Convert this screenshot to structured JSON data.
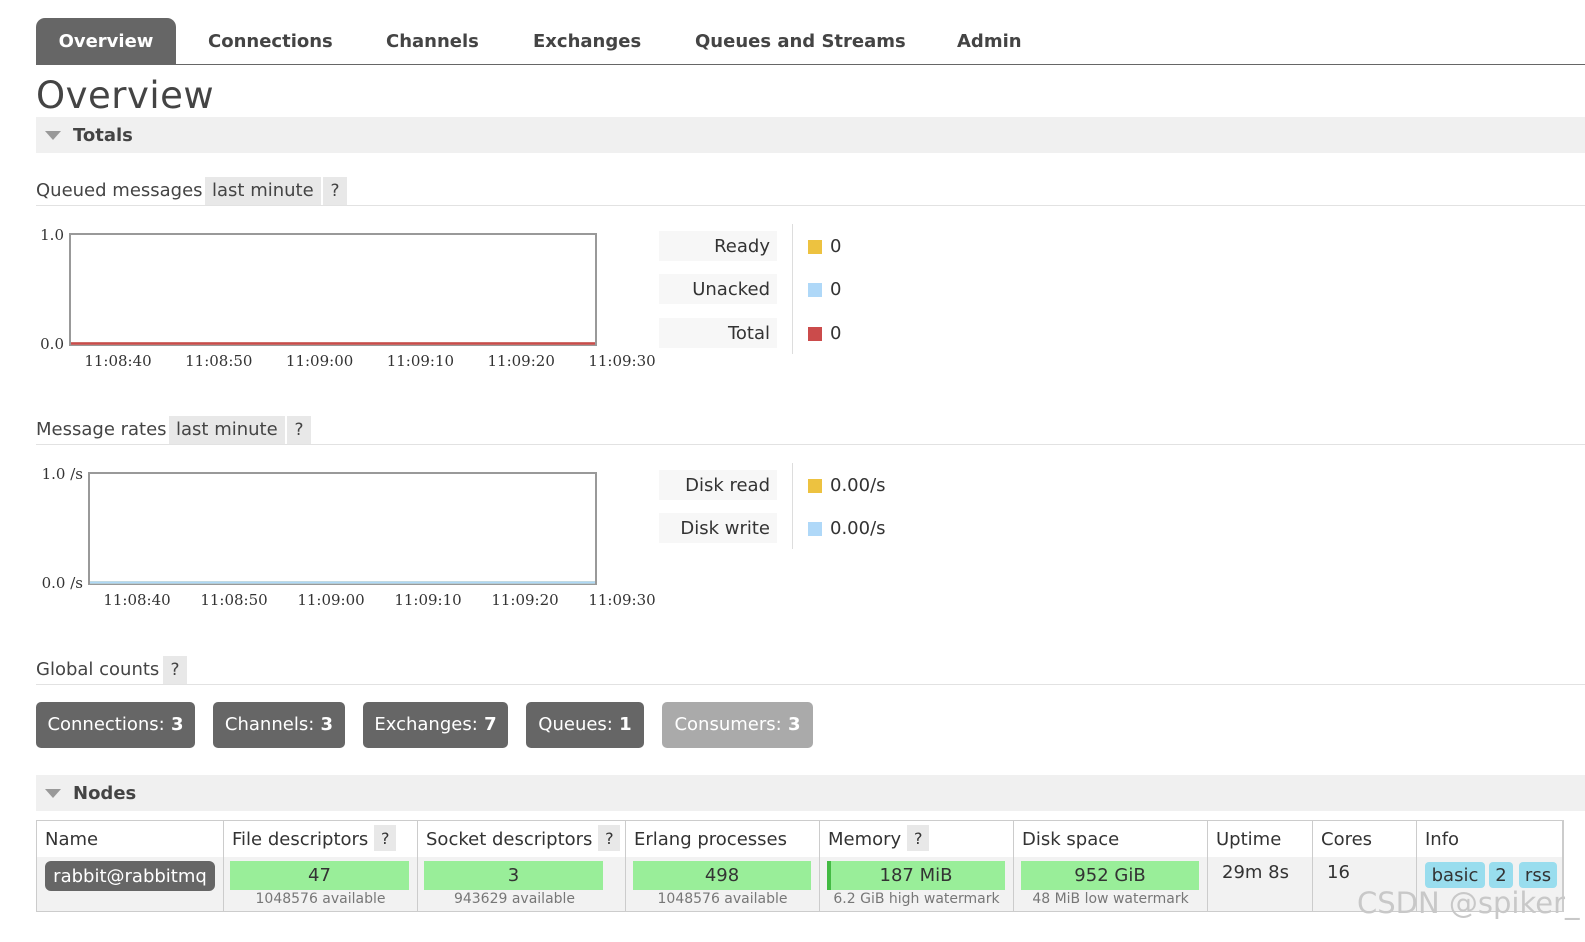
{
  "nav": {
    "tabs": [
      "Overview",
      "Connections",
      "Channels",
      "Exchanges",
      "Queues and Streams",
      "Admin"
    ],
    "active": "Overview"
  },
  "page_title": "Overview",
  "totals": {
    "section_label": "Totals",
    "queued": {
      "title": "Queued messages",
      "period": "last minute",
      "help": "?",
      "legend": [
        {
          "label": "Ready",
          "value": "0",
          "color": "#edc240"
        },
        {
          "label": "Unacked",
          "value": "0",
          "color": "#afd8f8"
        },
        {
          "label": "Total",
          "value": "0",
          "color": "#cb4b4b"
        }
      ]
    },
    "rates": {
      "title": "Message rates",
      "period": "last minute",
      "help": "?",
      "legend": [
        {
          "label": "Disk read",
          "value": "0.00/s",
          "color": "#edc240"
        },
        {
          "label": "Disk write",
          "value": "0.00/s",
          "color": "#afd8f8"
        }
      ]
    },
    "global_counts": {
      "title": "Global counts",
      "help": "?",
      "items": [
        {
          "label": "Connections:",
          "value": "3"
        },
        {
          "label": "Channels:",
          "value": "3"
        },
        {
          "label": "Exchanges:",
          "value": "7"
        },
        {
          "label": "Queues:",
          "value": "1"
        },
        {
          "label": "Consumers:",
          "value": "3"
        }
      ]
    }
  },
  "chart_data": [
    {
      "type": "line",
      "ylim": [
        0.0,
        1.0
      ],
      "y_ticks": [
        "1.0",
        "0.0"
      ],
      "x_ticks": [
        "11:08:40",
        "11:08:50",
        "11:09:00",
        "11:09:10",
        "11:09:20",
        "11:09:30"
      ],
      "series": [
        {
          "name": "Ready",
          "color": "#edc240",
          "values": [
            0,
            0,
            0,
            0,
            0,
            0
          ]
        },
        {
          "name": "Unacked",
          "color": "#afd8f8",
          "values": [
            0,
            0,
            0,
            0,
            0,
            0
          ]
        },
        {
          "name": "Total",
          "color": "#cb4b4b",
          "values": [
            0,
            0,
            0,
            0,
            0,
            0
          ]
        }
      ]
    },
    {
      "type": "line",
      "ylim": [
        0.0,
        1.0
      ],
      "y_ticks": [
        "1.0 /s",
        "0.0 /s"
      ],
      "x_ticks": [
        "11:08:40",
        "11:08:50",
        "11:09:00",
        "11:09:10",
        "11:09:20",
        "11:09:30"
      ],
      "series": [
        {
          "name": "Disk read",
          "color": "#edc240",
          "values": [
            0,
            0,
            0,
            0,
            0,
            0
          ]
        },
        {
          "name": "Disk write",
          "color": "#afd8f8",
          "values": [
            0,
            0,
            0,
            0,
            0,
            0
          ]
        }
      ]
    }
  ],
  "nodes": {
    "section_label": "Nodes",
    "headers": [
      {
        "label": "Name",
        "help": false
      },
      {
        "label": "File descriptors",
        "help": true
      },
      {
        "label": "Socket descriptors",
        "help": true
      },
      {
        "label": "Erlang processes",
        "help": false
      },
      {
        "label": "Memory",
        "help": true
      },
      {
        "label": "Disk space",
        "help": false
      },
      {
        "label": "Uptime",
        "help": false
      },
      {
        "label": "Cores",
        "help": false
      },
      {
        "label": "Info",
        "help": false
      }
    ],
    "row": {
      "name": "rabbit@rabbitmq",
      "file_descriptors": {
        "value": "47",
        "sub": "1048576 available"
      },
      "socket_descriptors": {
        "value": "3",
        "sub": "943629 available"
      },
      "erlang_processes": {
        "value": "498",
        "sub": "1048576 available"
      },
      "memory": {
        "value": "187 MiB",
        "sub": "6.2 GiB high watermark"
      },
      "disk_space": {
        "value": "952 GiB",
        "sub": "48 MiB low watermark"
      },
      "uptime": "29m 8s",
      "cores": "16",
      "info": [
        "basic",
        "2",
        "rss"
      ]
    }
  },
  "watermark": "CSDN @spiker_"
}
